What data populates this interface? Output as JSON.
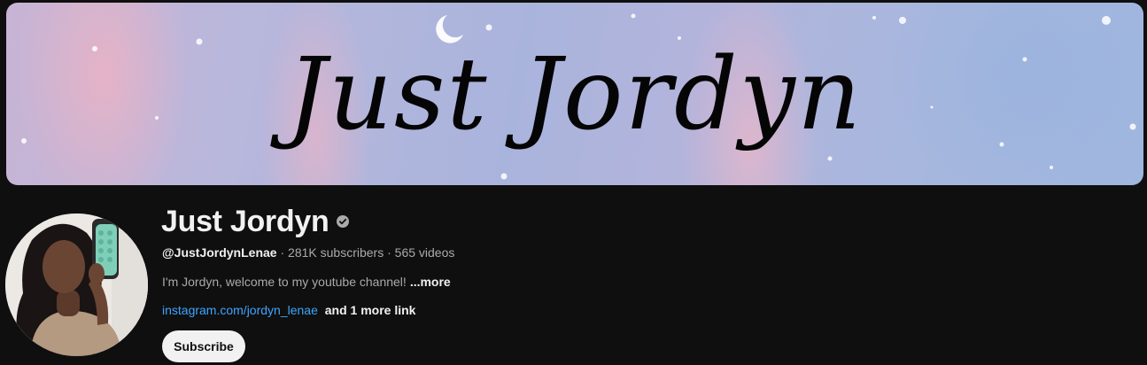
{
  "banner": {
    "title": "Just Jordyn"
  },
  "channel": {
    "name": "Just Jordyn",
    "verified": true,
    "handle": "@JustJordynLenae",
    "separator": "·",
    "subscribers": "281K subscribers",
    "videos": "565 videos",
    "description": "I'm Jordyn, welcome to my youtube channel!",
    "more_label": "...more",
    "link": "instagram.com/jordyn_lenae",
    "more_links_label": "and 1 more link"
  },
  "actions": {
    "subscribe_label": "Subscribe"
  },
  "colors": {
    "background": "#0f0f0f",
    "link": "#3ea6ff",
    "subscribe_bg": "#f1f1f1"
  }
}
